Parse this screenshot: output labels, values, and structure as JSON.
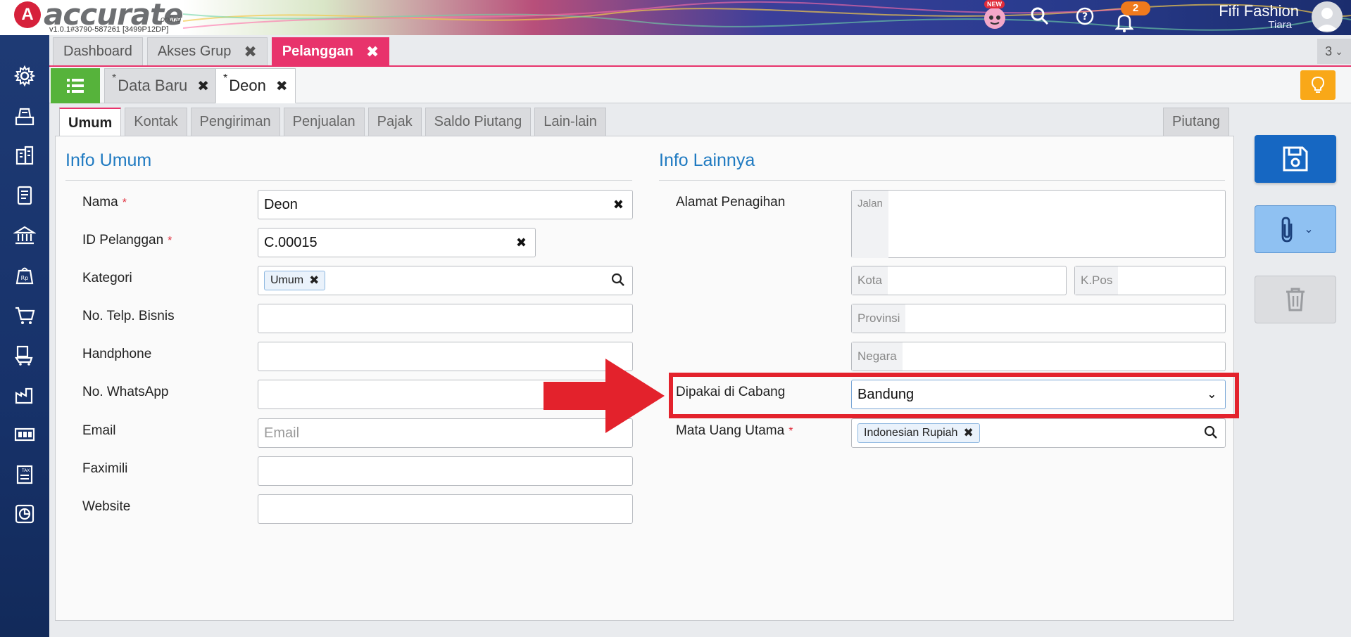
{
  "app": {
    "logo_text": "accurate",
    "logo_sub": "online",
    "version": "v1.0.1#3790-587261 [3499P12DP]",
    "new_badge": "NEW",
    "notification_count": "2",
    "user_name": "Fifi Fashion",
    "user_sub": "Tiara"
  },
  "tabs": [
    {
      "label": "Dashboard",
      "closable": false
    },
    {
      "label": "Akses Grup",
      "closable": true
    },
    {
      "label": "Pelanggan",
      "closable": true,
      "active": true
    }
  ],
  "tab_count": "3",
  "doc_tabs": [
    {
      "label": "Data Baru",
      "star": "*"
    },
    {
      "label": "Deon",
      "star": "*",
      "active": true
    }
  ],
  "subtabs": [
    "Umum",
    "Kontak",
    "Pengiriman",
    "Penjualan",
    "Pajak",
    "Saldo Piutang",
    "Lain-lain"
  ],
  "subtab_right": "Piutang",
  "info_umum": {
    "title": "Info Umum",
    "nama_label": "Nama",
    "nama_value": "Deon",
    "id_label": "ID Pelanggan",
    "id_value": "C.00015",
    "kategori_label": "Kategori",
    "kategori_chip": "Umum",
    "telp_label": "No. Telp. Bisnis",
    "hp_label": "Handphone",
    "wa_label": "No. WhatsApp",
    "email_label": "Email",
    "email_placeholder": "Email",
    "fax_label": "Faximili",
    "website_label": "Website"
  },
  "info_lainnya": {
    "title": "Info Lainnya",
    "alamat_label": "Alamat Penagihan",
    "jalan_placeholder": "Jalan",
    "kota_placeholder": "Kota",
    "kpos_placeholder": "K.Pos",
    "provinsi_placeholder": "Provinsi",
    "negara_placeholder": "Negara",
    "cabang_label": "Dipakai di Cabang",
    "cabang_value": "Bandung",
    "mata_uang_label": "Mata Uang Utama",
    "mata_uang_chip": "Indonesian Rupiah"
  },
  "required_mark": "*",
  "colors": {
    "accent_pink": "#e8336c",
    "primary_blue": "#1667c2",
    "title_blue": "#1f7ac1",
    "annotation_red": "#e3222c",
    "list_green": "#56b33b",
    "bulb_orange": "#f9a818"
  }
}
